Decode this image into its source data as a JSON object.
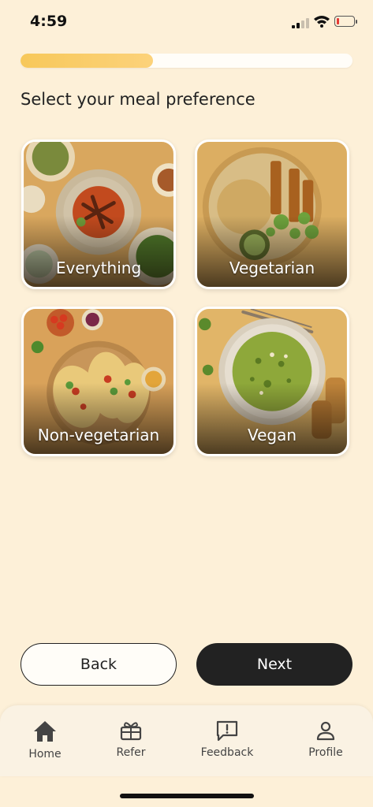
{
  "status_bar": {
    "time": "4:59",
    "battery_level": 0.15
  },
  "progress": {
    "fraction": 0.4
  },
  "title": "Select your meal preference",
  "options": [
    {
      "label": "Everything"
    },
    {
      "label": "Vegetarian"
    },
    {
      "label": "Non-vegetarian"
    },
    {
      "label": "Vegan"
    }
  ],
  "buttons": {
    "back": "Back",
    "next": "Next"
  },
  "tabs": [
    {
      "label": "Home",
      "icon": "home-icon"
    },
    {
      "label": "Refer",
      "icon": "gift-icon"
    },
    {
      "label": "Feedback",
      "icon": "feedback-icon"
    },
    {
      "label": "Profile",
      "icon": "person-icon"
    }
  ],
  "colors": {
    "background": "#fdf0d8",
    "progress": "#f7c85a",
    "primary_button": "#222222"
  }
}
